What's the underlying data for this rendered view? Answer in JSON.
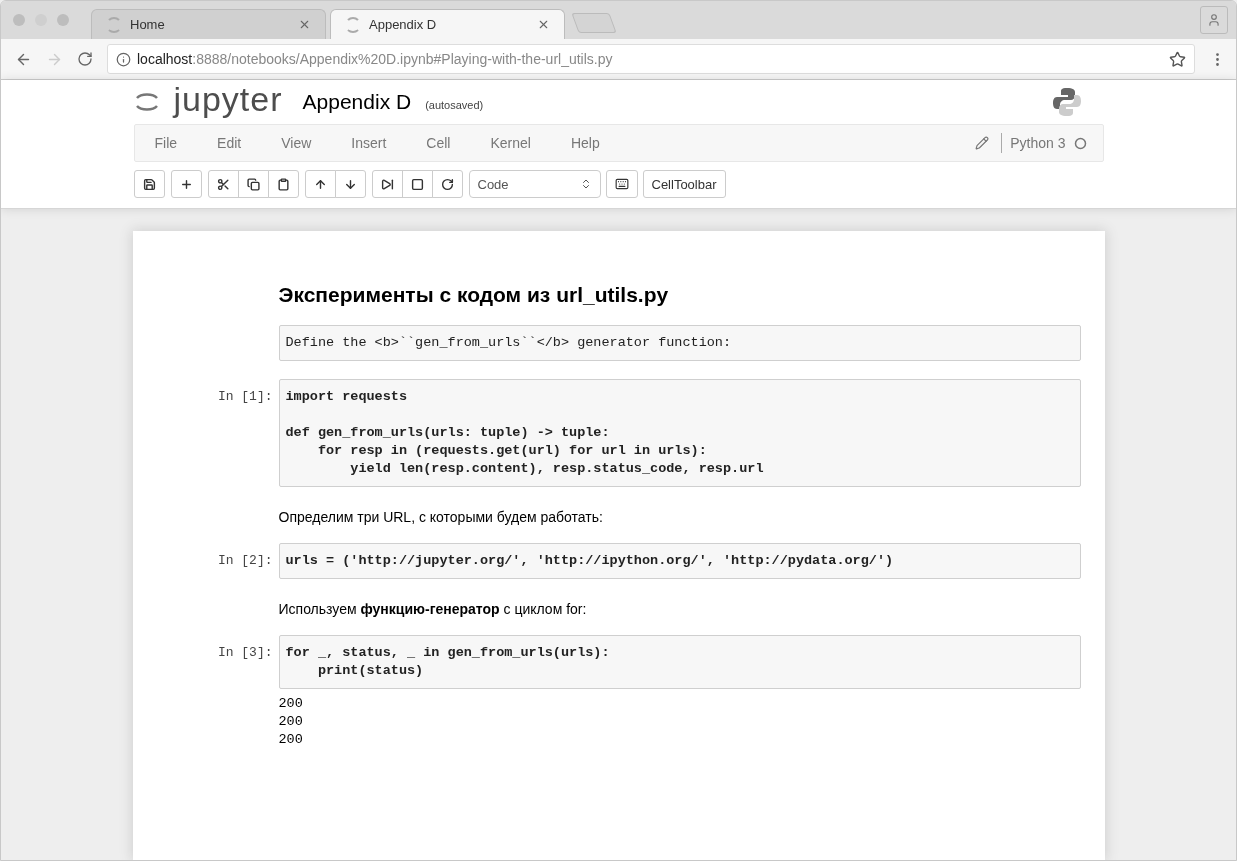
{
  "browser": {
    "tabs": [
      {
        "label": "Home",
        "selected": false
      },
      {
        "label": "Appendix D",
        "selected": true
      }
    ],
    "address": {
      "host": "localhost",
      "path": ":8888/notebooks/Appendix%20D.ipynb#Playing-with-the-url_utils.py"
    }
  },
  "notebook": {
    "logo_text": "jupyter",
    "title": "Appendix D",
    "save_status": "(autosaved)",
    "menu": [
      "File",
      "Edit",
      "View",
      "Insert",
      "Cell",
      "Kernel",
      "Help"
    ],
    "kernel": "Python 3",
    "toolbar": [
      [
        {
          "kind": "save"
        }
      ],
      [
        {
          "kind": "add"
        }
      ],
      [
        {
          "kind": "cut"
        },
        {
          "kind": "copy"
        },
        {
          "kind": "paste"
        }
      ],
      [
        {
          "kind": "up"
        },
        {
          "kind": "down"
        }
      ],
      [
        {
          "kind": "run"
        },
        {
          "kind": "stop"
        },
        {
          "kind": "restart"
        }
      ]
    ],
    "cell_type": "Code",
    "celltoolbar": "CellToolbar"
  },
  "cells": [
    {
      "kind": "heading",
      "text": "Эксперименты с кодом из url_utils.py"
    },
    {
      "kind": "raw",
      "text": "Define the <b>``gen_from_urls``</b> generator function:"
    },
    {
      "kind": "code",
      "prompt": "In [1]:",
      "text": "import requests\n\ndef gen_from_urls(urls: tuple) -> tuple:\n    for resp in (requests.get(url) for url in urls):\n        yield len(resp.content), resp.status_code, resp.url"
    },
    {
      "kind": "markdown",
      "text": "Определим три URL, с которыми будем работать:"
    },
    {
      "kind": "code",
      "prompt": "In [2]:",
      "text": "urls = ('http://jupyter.org/', 'http://ipython.org/', 'http://pydata.org/')"
    },
    {
      "kind": "markdown",
      "text": "Используем **функцию-генератор** с циклом for:"
    },
    {
      "kind": "code",
      "prompt": "In [3]:",
      "text": "for _, status, _ in gen_from_urls(urls):\n    print(status)"
    },
    {
      "kind": "output",
      "text": "200\n200\n200"
    }
  ]
}
